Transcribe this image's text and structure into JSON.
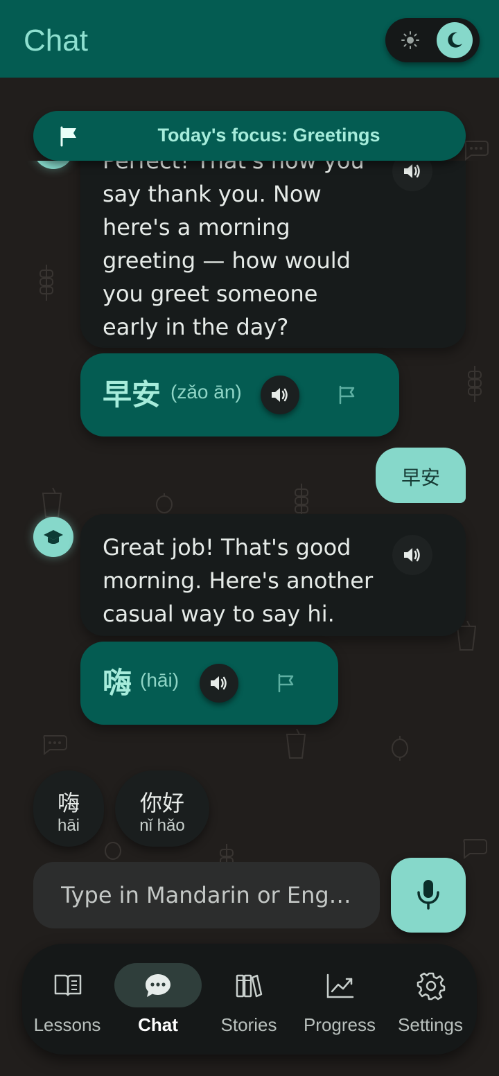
{
  "header": {
    "title": "Chat",
    "theme_toggle": {
      "light_icon": "sun-icon",
      "dark_icon": "moon-icon",
      "selected": "dark"
    }
  },
  "focus": {
    "text": "Today's focus: Greetings",
    "icon": "flag-icon"
  },
  "messages": [
    {
      "role": "tutor",
      "text": "Perfect! That's how you say thank you. Now here's a morning greeting — how would you greet someone early in the day?",
      "phrase": {
        "hanzi": "早安",
        "pinyin": "(zǎo ān)"
      }
    },
    {
      "role": "user",
      "text": "早安"
    },
    {
      "role": "tutor",
      "text": "Great job! That's good morning. Here's another casual way to say hi.",
      "phrase": {
        "hanzi": "嗨",
        "pinyin": "(hāi)"
      }
    }
  ],
  "suggestions": [
    {
      "hanzi": "嗨",
      "pinyin": "hāi"
    },
    {
      "hanzi": "你好",
      "pinyin": "nǐ hǎo"
    }
  ],
  "input": {
    "placeholder": "Type in Mandarin or Eng…",
    "value": ""
  },
  "nav": [
    {
      "label": "Lessons",
      "icon": "book-open-icon",
      "active": false
    },
    {
      "label": "Chat",
      "icon": "chat-bubble-icon",
      "active": true
    },
    {
      "label": "Stories",
      "icon": "books-icon",
      "active": false
    },
    {
      "label": "Progress",
      "icon": "chart-line-icon",
      "active": false
    },
    {
      "label": "Settings",
      "icon": "gear-icon",
      "active": false
    }
  ],
  "colors": {
    "primary": "#045c52",
    "accent": "#86d8ca",
    "background": "#211e1c",
    "bubble": "#171b1b"
  }
}
